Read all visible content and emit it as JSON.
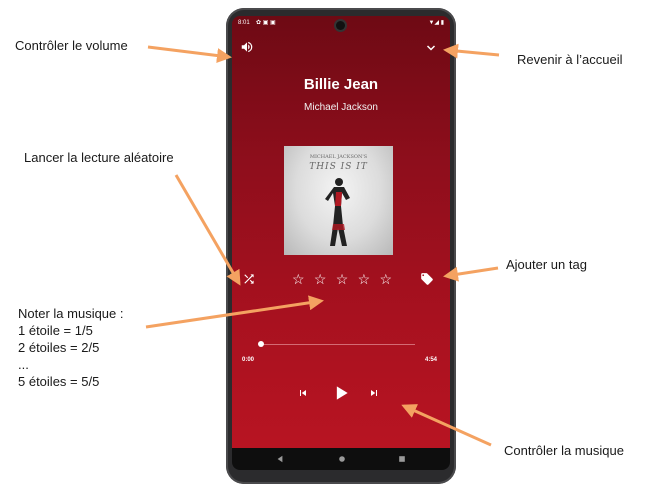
{
  "annotations": {
    "volume": "Contrôler le volume",
    "home": "Revenir à l’accueil",
    "shuffle": "Lancer la lecture aléatoire",
    "tag": "Ajouter un tag",
    "rate_lines": [
      "Noter la musique :",
      "1 étoile = 1/5",
      "2 étoiles = 2/5",
      "...",
      "5 étoiles = 5/5"
    ],
    "controls": "Contrôler la musique"
  },
  "player": {
    "status_time": "8:01",
    "song_title": "Billie Jean",
    "artist": "Michael Jackson",
    "cover_text": "THIS IS IT",
    "cover_top_text": "MICHAEL JACKSON'S",
    "rating": 0,
    "rating_max": 5,
    "elapsed": "0:00",
    "duration": "4:54",
    "progress_fraction": 0.0
  },
  "colors": {
    "accent_bg_top": "#6e0a14",
    "accent_bg_bottom": "#b81422",
    "arrow": "#f4a261"
  },
  "icons": [
    "volume-icon",
    "chevron-down-icon",
    "shuffle-icon",
    "tag-icon",
    "skip-previous-icon",
    "play-icon",
    "skip-next-icon",
    "nav-back-icon",
    "nav-home-icon",
    "nav-recents-icon"
  ]
}
